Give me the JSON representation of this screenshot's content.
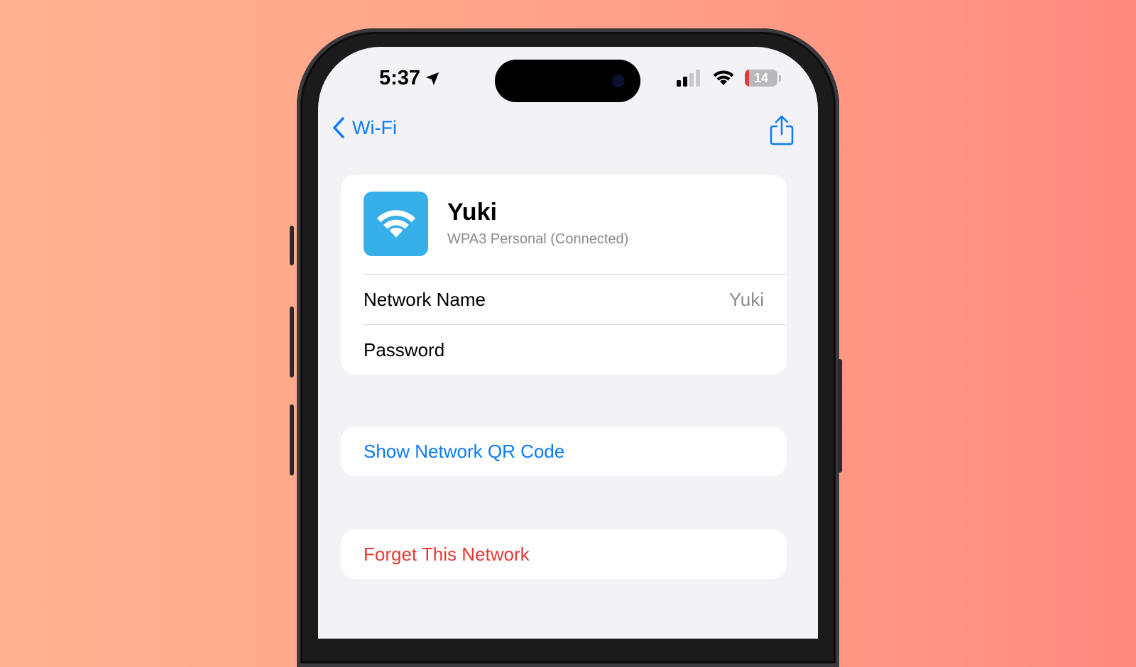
{
  "status_bar": {
    "time": "5:37",
    "battery_level": "14",
    "battery_fraction": 0.14,
    "signal_bars_active": 2,
    "signal_bars_total": 4
  },
  "icons": {
    "location": "location-arrow-icon",
    "signal": "cellular-signal-icon",
    "wifi": "wifi-icon",
    "battery": "battery-icon",
    "back": "chevron-left-icon",
    "share": "share-icon",
    "network": "wifi-icon"
  },
  "nav": {
    "back_label": "Wi-Fi"
  },
  "network": {
    "name": "Yuki",
    "subtitle": "WPA3 Personal (Connected)"
  },
  "rows": [
    {
      "label": "Network Name",
      "value": "Yuki"
    },
    {
      "label": "Password",
      "value": ""
    }
  ],
  "actions": {
    "show_qr": "Show Network QR Code",
    "forget": "Forget This Network"
  },
  "colors": {
    "accent": "#0a7aff",
    "destructive": "#e53935",
    "wifi_tile": "#36aee8"
  }
}
